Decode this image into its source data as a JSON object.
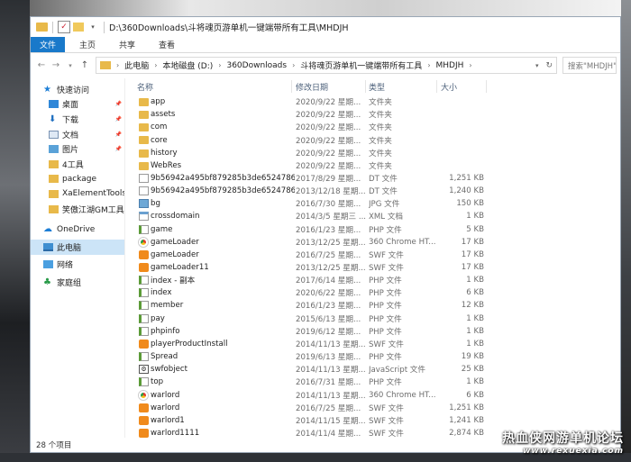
{
  "window": {
    "title": "D:\\360Downloads\\斗将魂页游单机一键端带所有工具\\MHDJH"
  },
  "ribbon": {
    "tabs": [
      "文件",
      "主页",
      "共享",
      "查看"
    ]
  },
  "address": {
    "crumbs": [
      "此电脑",
      "本地磁盘 (D:)",
      "360Downloads",
      "斗将魂页游单机一键端带所有工具",
      "MHDJH"
    ],
    "search_placeholder": "搜索\"MHDJH\""
  },
  "navpane": {
    "items": [
      {
        "label": "快速访问",
        "icon": "star-icon",
        "pinned": false
      },
      {
        "label": "桌面",
        "icon": "desktop-icon",
        "pinned": true
      },
      {
        "label": "下载",
        "icon": "download-icon",
        "pinned": true
      },
      {
        "label": "文档",
        "icon": "document-icon",
        "pinned": true
      },
      {
        "label": "图片",
        "icon": "pictures-icon",
        "pinned": true
      },
      {
        "label": "4工具",
        "icon": "folder-icon",
        "pinned": false
      },
      {
        "label": "package",
        "icon": "folder-icon",
        "pinned": false
      },
      {
        "label": "XaElementTools-2",
        "icon": "folder-icon",
        "pinned": false
      },
      {
        "label": "笑傲江湖GM工具",
        "icon": "folder-icon",
        "pinned": false
      },
      {
        "label": "OneDrive",
        "icon": "onedrive-icon",
        "pinned": false
      },
      {
        "label": "此电脑",
        "icon": "this-pc-icon",
        "pinned": false,
        "selected": true
      },
      {
        "label": "网络",
        "icon": "network-icon",
        "pinned": false
      },
      {
        "label": "家庭组",
        "icon": "homegroup-icon",
        "pinned": false
      }
    ]
  },
  "columns": {
    "name": "名称",
    "date": "修改日期",
    "type": "类型",
    "size": "大小"
  },
  "files": [
    {
      "name": "app",
      "date": "2020/9/22 星期...",
      "type": "文件夹",
      "size": "",
      "icon": "folder"
    },
    {
      "name": "assets",
      "date": "2020/9/22 星期...",
      "type": "文件夹",
      "size": "",
      "icon": "folder"
    },
    {
      "name": "com",
      "date": "2020/9/22 星期...",
      "type": "文件夹",
      "size": "",
      "icon": "folder"
    },
    {
      "name": "core",
      "date": "2020/9/22 星期...",
      "type": "文件夹",
      "size": "",
      "icon": "folder"
    },
    {
      "name": "history",
      "date": "2020/9/22 星期...",
      "type": "文件夹",
      "size": "",
      "icon": "folder"
    },
    {
      "name": "WebRes",
      "date": "2020/9/22 星期...",
      "type": "文件夹",
      "size": "",
      "icon": "folder"
    },
    {
      "name": "9b56942a495bf879285b3de6524786...",
      "date": "2017/8/29 星期...",
      "type": "DT 文件",
      "size": "1,251 KB",
      "icon": "dt"
    },
    {
      "name": "9b56942a495bf879285b3de6524786...",
      "date": "2013/12/18 星期...",
      "type": "DT 文件",
      "size": "1,240 KB",
      "icon": "dt"
    },
    {
      "name": "bg",
      "date": "2016/7/30 星期...",
      "type": "JPG 文件",
      "size": "150 KB",
      "icon": "jpg"
    },
    {
      "name": "crossdomain",
      "date": "2014/3/5 星期三 ...",
      "type": "XML 文档",
      "size": "1 KB",
      "icon": "xml"
    },
    {
      "name": "game",
      "date": "2016/1/23 星期...",
      "type": "PHP 文件",
      "size": "5 KB",
      "icon": "php"
    },
    {
      "name": "gameLoader",
      "date": "2013/12/25 星期...",
      "type": "360 Chrome HT...",
      "size": "17 KB",
      "icon": "chrome"
    },
    {
      "name": "gameLoader",
      "date": "2016/7/25 星期...",
      "type": "SWF 文件",
      "size": "17 KB",
      "icon": "swf"
    },
    {
      "name": "gameLoader11",
      "date": "2013/12/25 星期...",
      "type": "SWF 文件",
      "size": "17 KB",
      "icon": "swf"
    },
    {
      "name": "index - 副本",
      "date": "2017/6/14 星期...",
      "type": "PHP 文件",
      "size": "1 KB",
      "icon": "php"
    },
    {
      "name": "index",
      "date": "2020/6/22 星期...",
      "type": "PHP 文件",
      "size": "6 KB",
      "icon": "php"
    },
    {
      "name": "member",
      "date": "2016/1/23 星期...",
      "type": "PHP 文件",
      "size": "12 KB",
      "icon": "php"
    },
    {
      "name": "pay",
      "date": "2015/6/13 星期...",
      "type": "PHP 文件",
      "size": "1 KB",
      "icon": "php"
    },
    {
      "name": "phpinfo",
      "date": "2019/6/12 星期...",
      "type": "PHP 文件",
      "size": "1 KB",
      "icon": "php"
    },
    {
      "name": "playerProductInstall",
      "date": "2014/11/13 星期...",
      "type": "SWF 文件",
      "size": "1 KB",
      "icon": "swf"
    },
    {
      "name": "Spread",
      "date": "2019/6/13 星期...",
      "type": "PHP 文件",
      "size": "19 KB",
      "icon": "php"
    },
    {
      "name": "swfobject",
      "date": "2014/11/13 星期...",
      "type": "JavaScript 文件",
      "size": "25 KB",
      "icon": "js"
    },
    {
      "name": "top",
      "date": "2016/7/31 星期...",
      "type": "PHP 文件",
      "size": "1 KB",
      "icon": "php"
    },
    {
      "name": "warlord",
      "date": "2014/11/13 星期...",
      "type": "360 Chrome HT...",
      "size": "6 KB",
      "icon": "chrome"
    },
    {
      "name": "warlord",
      "date": "2016/7/25 星期...",
      "type": "SWF 文件",
      "size": "1,251 KB",
      "icon": "swf"
    },
    {
      "name": "warlord1",
      "date": "2014/11/15 星期...",
      "type": "SWF 文件",
      "size": "1,241 KB",
      "icon": "swf"
    },
    {
      "name": "warlord1111",
      "date": "2014/11/4 星期...",
      "type": "SWF 文件",
      "size": "2,874 KB",
      "icon": "swf"
    }
  ],
  "status": {
    "item_count": "28 个项目"
  },
  "watermark": {
    "line1": "热血侠网游单机论坛",
    "line2": "www.rexuexia.com"
  }
}
